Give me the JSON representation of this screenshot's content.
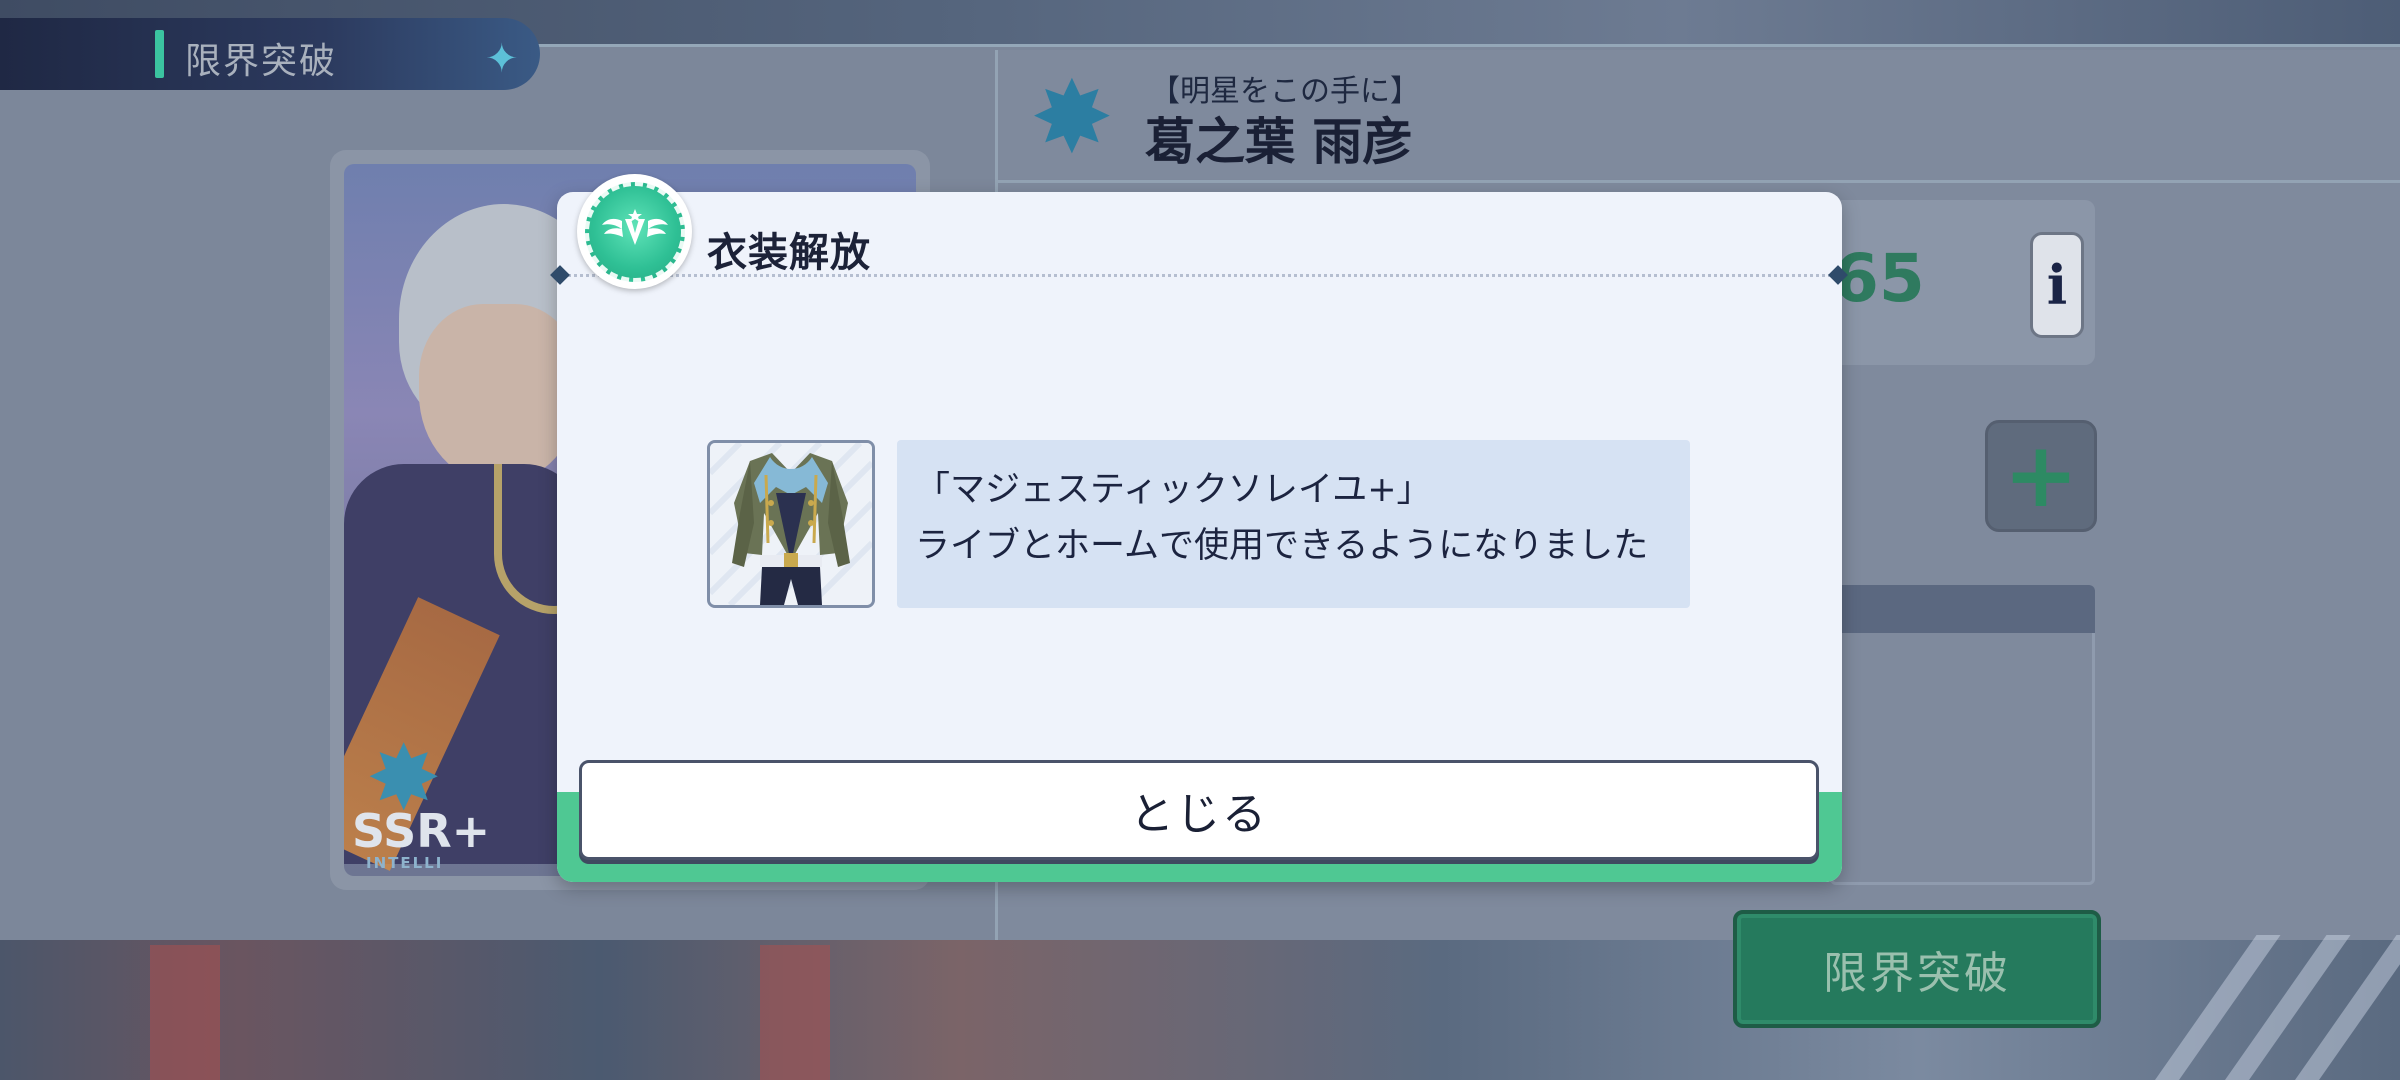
{
  "header": {
    "title": "限界突破"
  },
  "card": {
    "rarity": "SSR+",
    "attribute": "INTELLI"
  },
  "character": {
    "epithet": "【明星をこの手に】",
    "name": "葛之葉 雨彦"
  },
  "stats": {
    "value": "65",
    "info_label": "i",
    "plus_label": "+"
  },
  "limit_break_button": {
    "label": "限界突破"
  },
  "modal": {
    "title": "衣装解放",
    "costume_name": "「マジェスティックソレイユ+」",
    "message": "ライブとホームで使用できるようになりました",
    "close_label": "とじる"
  },
  "colors": {
    "accent_green": "#4fc893",
    "modal_bg": "#eff3fb",
    "message_bg": "#d6e2f3",
    "dark_navy": "#1c2238"
  }
}
